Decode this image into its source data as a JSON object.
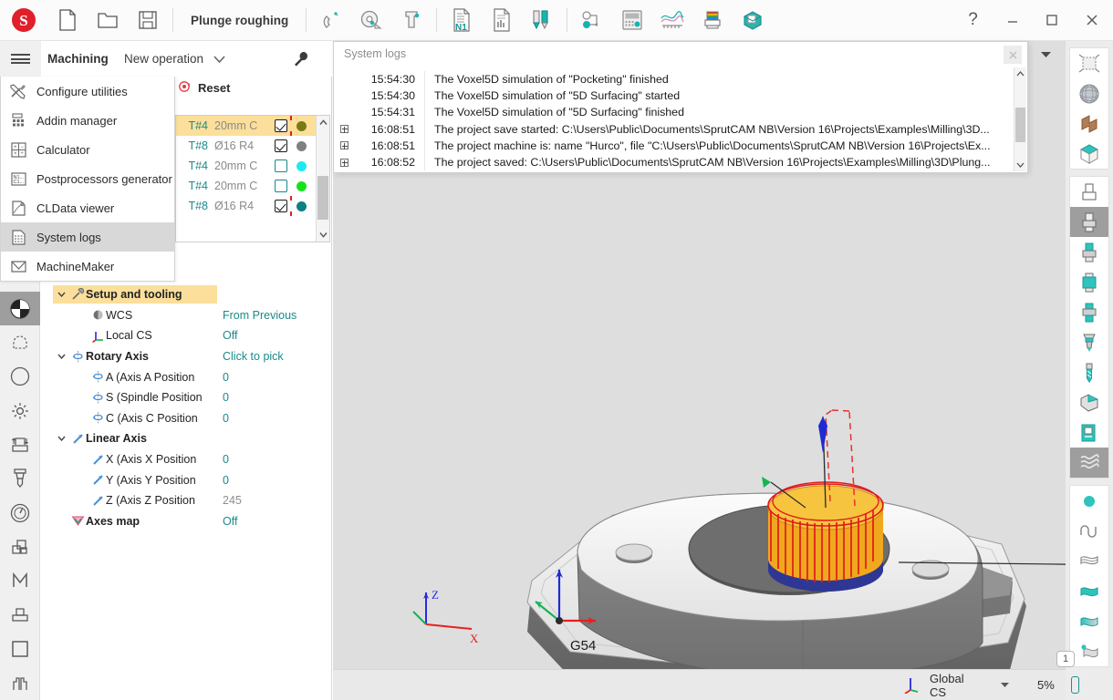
{
  "window": {
    "document_title": "Plunge roughing",
    "help_label": "?",
    "minimize_label": "—",
    "maximize_label": "□",
    "close_label": "✕"
  },
  "titlebar_icons": [
    {
      "name": "new-file-icon",
      "label": "New"
    },
    {
      "name": "open-folder-icon",
      "label": "Open"
    },
    {
      "name": "save-disk-icon",
      "label": "Save"
    },
    {
      "name": "magnet-snap-icon",
      "label": "Snap"
    },
    {
      "name": "measure-icon",
      "label": "Measure"
    },
    {
      "name": "caliper-icon",
      "label": "Caliper"
    },
    {
      "name": "nc-program-icon",
      "label": "N1"
    },
    {
      "name": "report-chart-icon",
      "label": "Report"
    },
    {
      "name": "tool-library-icon",
      "label": "Tools"
    },
    {
      "name": "workflow-node-icon",
      "label": "Workflow"
    },
    {
      "name": "machine-control-icon",
      "label": "Machine control"
    },
    {
      "name": "feed-graph-icon",
      "label": "Feeds"
    },
    {
      "name": "heatmap-stock-icon",
      "label": "Stock heatmap"
    },
    {
      "name": "fixture-box-icon",
      "label": "Fixture"
    }
  ],
  "ribbon": {
    "hamburger": "menu-icon",
    "tab_label": "Machining",
    "new_operation_label": "New operation",
    "caret": "▼",
    "wrench": "wrench-icon"
  },
  "flyout_menu": {
    "items": [
      {
        "label": "Configure utilities",
        "icon": "tools-icon",
        "selected": false
      },
      {
        "label": "Addin manager",
        "icon": "addin-grid-icon",
        "selected": false
      },
      {
        "label": "Calculator",
        "icon": "calculator-icon",
        "selected": false
      },
      {
        "label": "Postprocessors generator",
        "icon": "postprocessor-icon",
        "selected": false
      },
      {
        "label": "CLData viewer",
        "icon": "cldata-icon",
        "selected": false
      },
      {
        "label": "System logs",
        "icon": "system-logs-icon",
        "selected": true
      },
      {
        "label": "MachineMaker",
        "icon": "machinemaker-icon",
        "selected": false
      }
    ]
  },
  "left_rail": {
    "items": [
      {
        "name": "shading-mode-icon",
        "selected": true
      },
      {
        "name": "selection-marquee-icon",
        "selected": false
      },
      {
        "name": "navigation-compass-icon",
        "selected": false
      },
      {
        "name": "settings-gear-icon",
        "selected": false
      },
      {
        "name": "stock-transfer-icon",
        "selected": false
      },
      {
        "name": "endmill-tool-icon",
        "selected": false
      },
      {
        "name": "gauge-icon",
        "selected": false
      },
      {
        "name": "layers-icon",
        "selected": false
      },
      {
        "name": "machine-m-icon",
        "selected": false
      },
      {
        "name": "fixture-icon",
        "selected": false
      },
      {
        "name": "square-part-icon",
        "selected": false
      },
      {
        "name": "vise-icon",
        "selected": false
      }
    ]
  },
  "operation_panel": {
    "reset_label": "Reset",
    "reset_icon": "reset-icon",
    "tool_list": {
      "rows": [
        {
          "id": "T#4",
          "desc": "20mm C",
          "checked": true,
          "check_style": "dark",
          "dot": "#7a7a14",
          "selected": true,
          "tick": true
        },
        {
          "id": "T#8",
          "desc": "Ø16 R4",
          "checked": true,
          "check_style": "dark",
          "dot": "#808080",
          "selected": false,
          "tick": false
        },
        {
          "id": "T#4",
          "desc": "20mm C",
          "checked": false,
          "check_style": "teal",
          "dot": "#1fe8f5",
          "selected": false,
          "tick": false
        },
        {
          "id": "T#4",
          "desc": "20mm C",
          "checked": false,
          "check_style": "teal",
          "dot": "#16e21b",
          "selected": false,
          "tick": false
        },
        {
          "id": "T#8",
          "desc": "Ø16 R4",
          "checked": true,
          "check_style": "dark",
          "dot": "#0f7f82",
          "selected": false,
          "tick": true
        }
      ],
      "scroll_up": "▲",
      "scroll_down": "▼"
    },
    "tree": [
      {
        "label": "Setup and tooling",
        "value": "",
        "icon": "setup-tooling-icon",
        "bold": true,
        "level": 0,
        "caret": "⌄",
        "selected": true
      },
      {
        "label": "WCS",
        "value": "From Previous",
        "icon": "wcs-icon",
        "bold": false,
        "level": 1,
        "caret": "",
        "selected": false
      },
      {
        "label": "Local CS",
        "value": "Off",
        "icon": "local-cs-icon",
        "bold": false,
        "level": 1,
        "caret": "",
        "selected": false
      },
      {
        "label": "Rotary Axis",
        "value": "Click to pick",
        "icon": "rotary-axis-icon",
        "bold": true,
        "level": 0,
        "caret": "⌄",
        "selected": false
      },
      {
        "label": "A (Axis A Position",
        "value": "0",
        "icon": "rotary-axis-icon",
        "bold": false,
        "level": 1,
        "caret": "",
        "selected": false
      },
      {
        "label": "S (Spindle Position",
        "value": "0",
        "icon": "rotary-axis-icon",
        "bold": false,
        "level": 1,
        "caret": "",
        "selected": false
      },
      {
        "label": "C (Axis C Position",
        "value": "0",
        "icon": "rotary-axis-icon",
        "bold": false,
        "level": 1,
        "caret": "",
        "selected": false
      },
      {
        "label": "Linear Axis",
        "value": "",
        "icon": "linear-axis-icon",
        "bold": true,
        "level": 0,
        "caret": "⌄",
        "selected": false
      },
      {
        "label": "X (Axis X Position",
        "value": "0",
        "icon": "linear-axis-icon",
        "bold": false,
        "level": 1,
        "caret": "",
        "selected": false
      },
      {
        "label": "Y (Axis Y Position",
        "value": "0",
        "icon": "linear-axis-icon",
        "bold": false,
        "level": 1,
        "caret": "",
        "selected": false
      },
      {
        "label": "Z (Axis Z Position",
        "value": "245",
        "icon": "linear-axis-icon",
        "bold": false,
        "level": 1,
        "caret": "",
        "selected": false,
        "value_gray": true
      },
      {
        "label": "Axes map",
        "value": "Off",
        "icon": "axes-map-icon",
        "bold": true,
        "level": 0,
        "caret": "",
        "selected": false
      }
    ]
  },
  "system_logs": {
    "title": "System logs",
    "close_label": "✕",
    "collapse_caret": "▼",
    "scroll_up": "▲",
    "scroll_down": "▼",
    "rows": [
      {
        "expandable": false,
        "time": "15:54:30",
        "message": "The Voxel5D simulation of \"Pocketing\" finished"
      },
      {
        "expandable": false,
        "time": "15:54:30",
        "message": "The Voxel5D simulation of \"5D Surfacing\" started"
      },
      {
        "expandable": false,
        "time": "15:54:31",
        "message": "The Voxel5D simulation of \"5D Surfacing\" finished"
      },
      {
        "expandable": true,
        "time": "16:08:51",
        "message": "The project save started: C:\\Users\\Public\\Documents\\SprutCAM NB\\Version 16\\Projects\\Examples\\Milling\\3D..."
      },
      {
        "expandable": true,
        "time": "16:08:51",
        "message": "The project machine is: name \"Hurco\", file \"C:\\Users\\Public\\Documents\\SprutCAM NB\\Version 16\\Projects\\Ex..."
      },
      {
        "expandable": true,
        "time": "16:08:52",
        "message": "The project saved: C:\\Users\\Public\\Documents\\SprutCAM NB\\Version 16\\Projects\\Examples\\Milling\\3D\\Plung..."
      }
    ]
  },
  "viewport": {
    "wcs_label": "G54",
    "axis_x": "X",
    "axis_z": "Z",
    "cs_label": "Global CS",
    "cs_caret": "▼",
    "zoom_level": "5%",
    "view_badge": "1",
    "cs_icon": "coordinate-system-icon"
  },
  "right_rail": {
    "group1": [
      {
        "name": "select-all-icon",
        "selected": false
      },
      {
        "name": "globe-surface-icon",
        "selected": false
      },
      {
        "name": "face-surface-icon",
        "selected": false
      },
      {
        "name": "solid-box-icon",
        "selected": false
      }
    ],
    "group2": [
      {
        "name": "tool-holder-hidden-icon",
        "selected": false
      },
      {
        "name": "tool-holder-gray-icon",
        "selected": true
      },
      {
        "name": "tool-shank-icon",
        "selected": false
      },
      {
        "name": "tool-body-icon",
        "selected": false
      },
      {
        "name": "tool-full-icon",
        "selected": false
      },
      {
        "name": "tool-assembly-icon",
        "selected": false
      },
      {
        "name": "drill-tool-icon",
        "selected": false
      },
      {
        "name": "workpiece-icon",
        "selected": false
      },
      {
        "name": "machine-part-icon",
        "selected": false
      },
      {
        "name": "toolpath-hatch-icon",
        "selected": true
      }
    ],
    "group3": [
      {
        "name": "point-dot-icon",
        "selected": false
      },
      {
        "name": "curve-wave-icon",
        "selected": false
      },
      {
        "name": "mesh-surface-icon",
        "selected": false
      },
      {
        "name": "solid-surface-icon",
        "selected": false
      },
      {
        "name": "shaded-surface-icon",
        "selected": false
      },
      {
        "name": "surface-point-icon",
        "selected": false
      }
    ]
  }
}
